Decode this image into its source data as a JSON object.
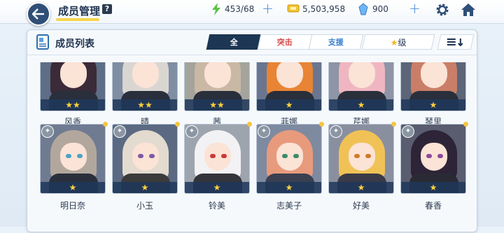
{
  "header": {
    "title": "成员管理",
    "help_label": "?",
    "ap": "453/68",
    "credits": "5,503,958",
    "gems": "900",
    "plus": "+"
  },
  "panel": {
    "title": "成员列表",
    "tabs": [
      "全",
      "突击",
      "支援"
    ],
    "sort_label": "级",
    "star": "★"
  },
  "row1": [
    {
      "name": "风香",
      "stars": "★★"
    },
    {
      "name": "晴",
      "stars": "★★"
    },
    {
      "name": "茜",
      "stars": "★★"
    },
    {
      "name": "菲娜",
      "stars": "★"
    },
    {
      "name": "芹娜",
      "stars": "★"
    },
    {
      "name": "琴里",
      "stars": "★"
    }
  ],
  "row2": [
    {
      "name": "明日奈",
      "stars": "★"
    },
    {
      "name": "小玉",
      "stars": "★"
    },
    {
      "name": "铃美",
      "stars": "★"
    },
    {
      "name": "志美子",
      "stars": "★"
    },
    {
      "name": "好美",
      "stars": "★"
    },
    {
      "name": "春香",
      "stars": "★"
    }
  ],
  "colors": {
    "accent": "#1d3653",
    "attack": "#d94b4b",
    "support": "#3b7fd1",
    "star": "#ffd23a"
  },
  "icons": {
    "back": "back-arrow-icon",
    "ap": "lightning-icon",
    "credits": "ticket-icon",
    "gems": "gem-icon",
    "settings": "gear-icon",
    "home": "home-icon",
    "pin": "pin-icon"
  }
}
